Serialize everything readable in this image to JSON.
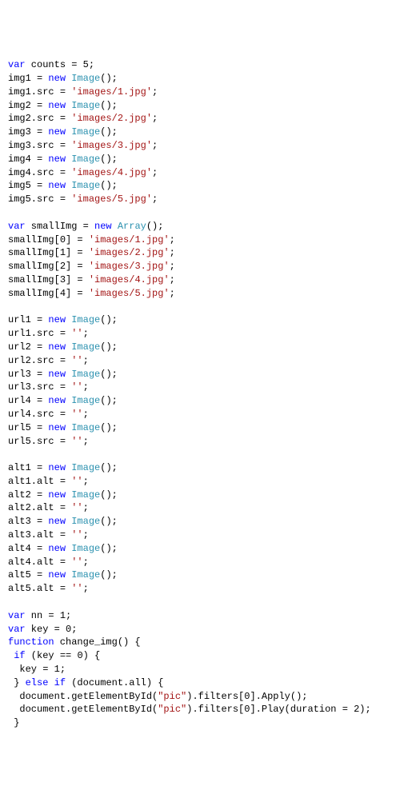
{
  "code": [
    [
      [
        "kw",
        "var"
      ],
      [
        "id",
        " counts "
      ],
      [
        "op",
        "= "
      ],
      [
        "num",
        "5"
      ],
      [
        "op",
        ";"
      ]
    ],
    [
      [
        "id",
        "img1 "
      ],
      [
        "op",
        "= "
      ],
      [
        "kw",
        "new"
      ],
      [
        "id",
        " "
      ],
      [
        "type",
        "Image"
      ],
      [
        "op",
        "();"
      ]
    ],
    [
      [
        "id",
        "img1.src "
      ],
      [
        "op",
        "= "
      ],
      [
        "str",
        "'images/1.jpg'"
      ],
      [
        "op",
        ";"
      ]
    ],
    [
      [
        "id",
        "img2 "
      ],
      [
        "op",
        "= "
      ],
      [
        "kw",
        "new"
      ],
      [
        "id",
        " "
      ],
      [
        "type",
        "Image"
      ],
      [
        "op",
        "();"
      ]
    ],
    [
      [
        "id",
        "img2.src "
      ],
      [
        "op",
        "= "
      ],
      [
        "str",
        "'images/2.jpg'"
      ],
      [
        "op",
        ";"
      ]
    ],
    [
      [
        "id",
        "img3 "
      ],
      [
        "op",
        "= "
      ],
      [
        "kw",
        "new"
      ],
      [
        "id",
        " "
      ],
      [
        "type",
        "Image"
      ],
      [
        "op",
        "();"
      ]
    ],
    [
      [
        "id",
        "img3.src "
      ],
      [
        "op",
        "= "
      ],
      [
        "str",
        "'images/3.jpg'"
      ],
      [
        "op",
        ";"
      ]
    ],
    [
      [
        "id",
        "img4 "
      ],
      [
        "op",
        "= "
      ],
      [
        "kw",
        "new"
      ],
      [
        "id",
        " "
      ],
      [
        "type",
        "Image"
      ],
      [
        "op",
        "();"
      ]
    ],
    [
      [
        "id",
        "img4.src "
      ],
      [
        "op",
        "= "
      ],
      [
        "str",
        "'images/4.jpg'"
      ],
      [
        "op",
        ";"
      ]
    ],
    [
      [
        "id",
        "img5 "
      ],
      [
        "op",
        "= "
      ],
      [
        "kw",
        "new"
      ],
      [
        "id",
        " "
      ],
      [
        "type",
        "Image"
      ],
      [
        "op",
        "();"
      ]
    ],
    [
      [
        "id",
        "img5.src "
      ],
      [
        "op",
        "= "
      ],
      [
        "str",
        "'images/5.jpg'"
      ],
      [
        "op",
        ";"
      ]
    ],
    [
      [
        "id",
        ""
      ]
    ],
    [
      [
        "kw",
        "var"
      ],
      [
        "id",
        " smallImg "
      ],
      [
        "op",
        "= "
      ],
      [
        "kw",
        "new"
      ],
      [
        "id",
        " "
      ],
      [
        "type",
        "Array"
      ],
      [
        "op",
        "();"
      ]
    ],
    [
      [
        "id",
        "smallImg["
      ],
      [
        "num",
        "0"
      ],
      [
        "id",
        "] "
      ],
      [
        "op",
        "= "
      ],
      [
        "str",
        "'images/1.jpg'"
      ],
      [
        "op",
        ";"
      ]
    ],
    [
      [
        "id",
        "smallImg["
      ],
      [
        "num",
        "1"
      ],
      [
        "id",
        "] "
      ],
      [
        "op",
        "= "
      ],
      [
        "str",
        "'images/2.jpg'"
      ],
      [
        "op",
        ";"
      ]
    ],
    [
      [
        "id",
        "smallImg["
      ],
      [
        "num",
        "2"
      ],
      [
        "id",
        "] "
      ],
      [
        "op",
        "= "
      ],
      [
        "str",
        "'images/3.jpg'"
      ],
      [
        "op",
        ";"
      ]
    ],
    [
      [
        "id",
        "smallImg["
      ],
      [
        "num",
        "3"
      ],
      [
        "id",
        "] "
      ],
      [
        "op",
        "= "
      ],
      [
        "str",
        "'images/4.jpg'"
      ],
      [
        "op",
        ";"
      ]
    ],
    [
      [
        "id",
        "smallImg["
      ],
      [
        "num",
        "4"
      ],
      [
        "id",
        "] "
      ],
      [
        "op",
        "= "
      ],
      [
        "str",
        "'images/5.jpg'"
      ],
      [
        "op",
        ";"
      ]
    ],
    [
      [
        "id",
        ""
      ]
    ],
    [
      [
        "id",
        "url1 "
      ],
      [
        "op",
        "= "
      ],
      [
        "kw",
        "new"
      ],
      [
        "id",
        " "
      ],
      [
        "type",
        "Image"
      ],
      [
        "op",
        "();"
      ]
    ],
    [
      [
        "id",
        "url1.src "
      ],
      [
        "op",
        "= "
      ],
      [
        "str",
        "''"
      ],
      [
        "op",
        ";"
      ]
    ],
    [
      [
        "id",
        "url2 "
      ],
      [
        "op",
        "= "
      ],
      [
        "kw",
        "new"
      ],
      [
        "id",
        " "
      ],
      [
        "type",
        "Image"
      ],
      [
        "op",
        "();"
      ]
    ],
    [
      [
        "id",
        "url2.src "
      ],
      [
        "op",
        "= "
      ],
      [
        "str",
        "''"
      ],
      [
        "op",
        ";"
      ]
    ],
    [
      [
        "id",
        "url3 "
      ],
      [
        "op",
        "= "
      ],
      [
        "kw",
        "new"
      ],
      [
        "id",
        " "
      ],
      [
        "type",
        "Image"
      ],
      [
        "op",
        "();"
      ]
    ],
    [
      [
        "id",
        "url3.src "
      ],
      [
        "op",
        "= "
      ],
      [
        "str",
        "''"
      ],
      [
        "op",
        ";"
      ]
    ],
    [
      [
        "id",
        "url4 "
      ],
      [
        "op",
        "= "
      ],
      [
        "kw",
        "new"
      ],
      [
        "id",
        " "
      ],
      [
        "type",
        "Image"
      ],
      [
        "op",
        "();"
      ]
    ],
    [
      [
        "id",
        "url4.src "
      ],
      [
        "op",
        "= "
      ],
      [
        "str",
        "''"
      ],
      [
        "op",
        ";"
      ]
    ],
    [
      [
        "id",
        "url5 "
      ],
      [
        "op",
        "= "
      ],
      [
        "kw",
        "new"
      ],
      [
        "id",
        " "
      ],
      [
        "type",
        "Image"
      ],
      [
        "op",
        "();"
      ]
    ],
    [
      [
        "id",
        "url5.src "
      ],
      [
        "op",
        "= "
      ],
      [
        "str",
        "''"
      ],
      [
        "op",
        ";"
      ]
    ],
    [
      [
        "id",
        ""
      ]
    ],
    [
      [
        "id",
        "alt1 "
      ],
      [
        "op",
        "= "
      ],
      [
        "kw",
        "new"
      ],
      [
        "id",
        " "
      ],
      [
        "type",
        "Image"
      ],
      [
        "op",
        "();"
      ]
    ],
    [
      [
        "id",
        "alt1.alt "
      ],
      [
        "op",
        "= "
      ],
      [
        "str",
        "''"
      ],
      [
        "op",
        ";"
      ]
    ],
    [
      [
        "id",
        "alt2 "
      ],
      [
        "op",
        "= "
      ],
      [
        "kw",
        "new"
      ],
      [
        "id",
        " "
      ],
      [
        "type",
        "Image"
      ],
      [
        "op",
        "();"
      ]
    ],
    [
      [
        "id",
        "alt2.alt "
      ],
      [
        "op",
        "= "
      ],
      [
        "str",
        "''"
      ],
      [
        "op",
        ";"
      ]
    ],
    [
      [
        "id",
        "alt3 "
      ],
      [
        "op",
        "= "
      ],
      [
        "kw",
        "new"
      ],
      [
        "id",
        " "
      ],
      [
        "type",
        "Image"
      ],
      [
        "op",
        "();"
      ]
    ],
    [
      [
        "id",
        "alt3.alt "
      ],
      [
        "op",
        "= "
      ],
      [
        "str",
        "''"
      ],
      [
        "op",
        ";"
      ]
    ],
    [
      [
        "id",
        "alt4 "
      ],
      [
        "op",
        "= "
      ],
      [
        "kw",
        "new"
      ],
      [
        "id",
        " "
      ],
      [
        "type",
        "Image"
      ],
      [
        "op",
        "();"
      ]
    ],
    [
      [
        "id",
        "alt4.alt "
      ],
      [
        "op",
        "= "
      ],
      [
        "str",
        "''"
      ],
      [
        "op",
        ";"
      ]
    ],
    [
      [
        "id",
        "alt5 "
      ],
      [
        "op",
        "= "
      ],
      [
        "kw",
        "new"
      ],
      [
        "id",
        " "
      ],
      [
        "type",
        "Image"
      ],
      [
        "op",
        "();"
      ]
    ],
    [
      [
        "id",
        "alt5.alt "
      ],
      [
        "op",
        "= "
      ],
      [
        "str",
        "''"
      ],
      [
        "op",
        ";"
      ]
    ],
    [
      [
        "id",
        ""
      ]
    ],
    [
      [
        "kw",
        "var"
      ],
      [
        "id",
        " nn "
      ],
      [
        "op",
        "= "
      ],
      [
        "num",
        "1"
      ],
      [
        "op",
        ";"
      ]
    ],
    [
      [
        "kw",
        "var"
      ],
      [
        "id",
        " key "
      ],
      [
        "op",
        "= "
      ],
      [
        "num",
        "0"
      ],
      [
        "op",
        ";"
      ]
    ],
    [
      [
        "kw",
        "function"
      ],
      [
        "id",
        " change_img() {"
      ]
    ],
    [
      [
        "id",
        " "
      ],
      [
        "kw",
        "if"
      ],
      [
        "id",
        " (key "
      ],
      [
        "op",
        "== "
      ],
      [
        "num",
        "0"
      ],
      [
        "id",
        ") {"
      ]
    ],
    [
      [
        "id",
        "  key "
      ],
      [
        "op",
        "= "
      ],
      [
        "num",
        "1"
      ],
      [
        "op",
        ";"
      ]
    ],
    [
      [
        "id",
        " } "
      ],
      [
        "kw",
        "else"
      ],
      [
        "id",
        " "
      ],
      [
        "kw",
        "if"
      ],
      [
        "id",
        " (document.all) {"
      ]
    ],
    [
      [
        "id",
        "  document.getElementById("
      ],
      [
        "str",
        "\"pic\""
      ],
      [
        "id",
        ").filters["
      ],
      [
        "num",
        "0"
      ],
      [
        "id",
        "].Apply();"
      ]
    ],
    [
      [
        "id",
        "  document.getElementById("
      ],
      [
        "str",
        "\"pic\""
      ],
      [
        "id",
        ").filters["
      ],
      [
        "num",
        "0"
      ],
      [
        "id",
        "].Play(duration "
      ],
      [
        "op",
        "= "
      ],
      [
        "num",
        "2"
      ],
      [
        "id",
        ");"
      ]
    ],
    [
      [
        "id",
        " }"
      ]
    ]
  ]
}
